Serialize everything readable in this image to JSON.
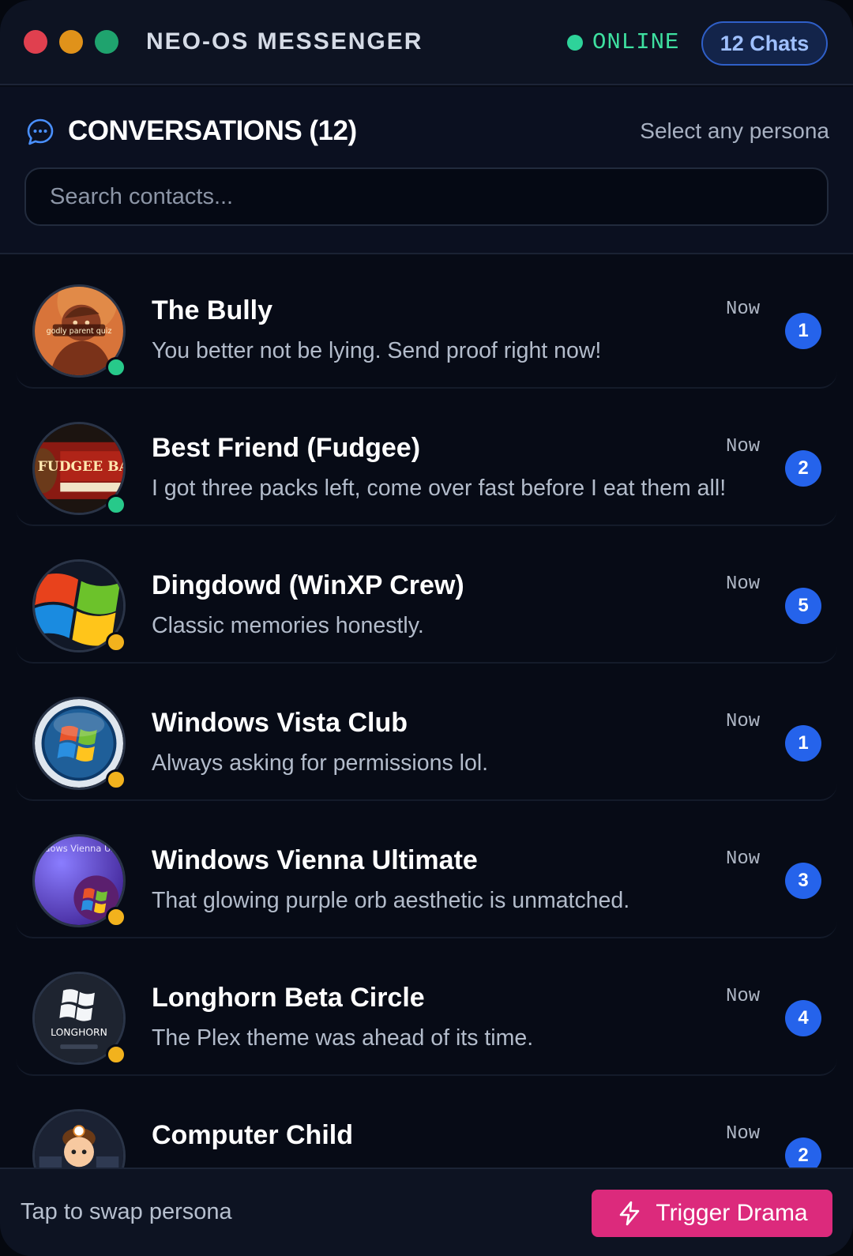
{
  "titlebar": {
    "title": "NEO-OS MESSENGER",
    "status": "ONLINE",
    "chats_pill": "12 Chats",
    "colors": {
      "close": "#e0404f",
      "minimize": "#e0921a",
      "maximize": "#1fa36e",
      "status": "#3ee0a0"
    }
  },
  "header": {
    "title": "CONVERSATIONS (12)",
    "hint": "Select any persona",
    "icon": "chat-bubble-icon"
  },
  "search": {
    "placeholder": "Search contacts...",
    "value": ""
  },
  "conversations": [
    {
      "name": "The Bully",
      "preview": "You better not be lying. Send proof right now!",
      "time": "Now",
      "unread": "1",
      "presence": "online",
      "avatar": "cartoon-character-avatar",
      "avatar_text": "godly parent quiz"
    },
    {
      "name": "Best Friend (Fudgee)",
      "preview": "I got three packs left, come over fast before I eat them all!",
      "time": "Now",
      "unread": "2",
      "presence": "online",
      "avatar": "fudgee-barr-snack-avatar",
      "avatar_text": "FUDGEE BARR"
    },
    {
      "name": "Dingdowd (WinXP Crew)",
      "preview": "Classic memories honestly.",
      "time": "Now",
      "unread": "5",
      "presence": "away",
      "avatar": "windows-xp-logo-avatar"
    },
    {
      "name": "Windows Vista Club",
      "preview": "Always asking for permissions lol.",
      "time": "Now",
      "unread": "1",
      "presence": "away",
      "avatar": "windows-vista-orb-avatar"
    },
    {
      "name": "Windows Vienna Ultimate",
      "preview": "That glowing purple orb aesthetic is unmatched.",
      "time": "Now",
      "unread": "3",
      "presence": "away",
      "avatar": "windows-vienna-orb-avatar",
      "avatar_text": "indows Vienna Ultimate"
    },
    {
      "name": "Longhorn Beta Circle",
      "preview": "The Plex theme was ahead of its time.",
      "time": "Now",
      "unread": "4",
      "presence": "away",
      "avatar": "longhorn-boot-screen-avatar",
      "avatar_text": "LONGHORN"
    },
    {
      "name": "Computer Child",
      "preview": "",
      "time": "Now",
      "unread": "2",
      "presence": "",
      "avatar": "cartoon-kid-avatar"
    }
  ],
  "footer": {
    "hint": "Tap to swap persona",
    "button_label": "Trigger Drama",
    "button_icon": "lightning-icon",
    "button_color": "#dc2a7c"
  },
  "colors": {
    "accent": "#2563eb",
    "online": "#27c98a",
    "away": "#f2b21d"
  }
}
